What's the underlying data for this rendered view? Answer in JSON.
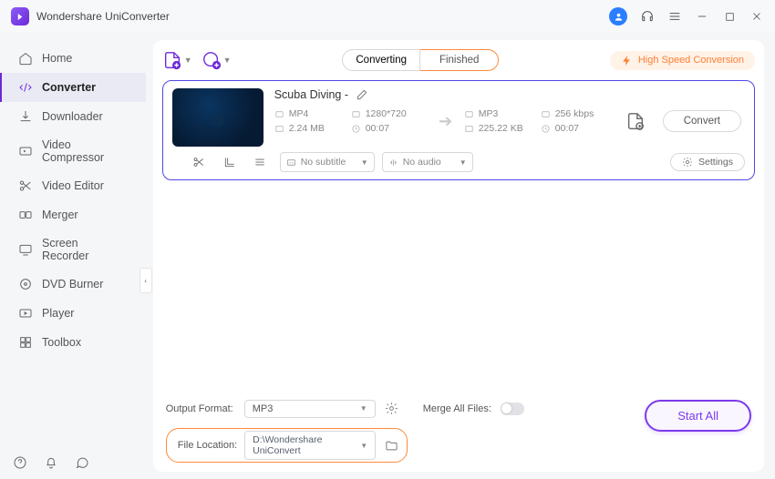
{
  "app": {
    "title": "Wondershare UniConverter"
  },
  "sidebar": {
    "items": [
      {
        "label": "Home"
      },
      {
        "label": "Converter"
      },
      {
        "label": "Downloader"
      },
      {
        "label": "Video Compressor"
      },
      {
        "label": "Video Editor"
      },
      {
        "label": "Merger"
      },
      {
        "label": "Screen Recorder"
      },
      {
        "label": "DVD Burner"
      },
      {
        "label": "Player"
      },
      {
        "label": "Toolbox"
      }
    ]
  },
  "tabs": {
    "converting": "Converting",
    "finished": "Finished"
  },
  "top": {
    "high_speed": "High Speed Conversion"
  },
  "file": {
    "name": "Scuba Diving - ",
    "src": {
      "format": "MP4",
      "resolution": "1280*720",
      "size": "2.24 MB",
      "duration": "00:07"
    },
    "dst": {
      "format": "MP3",
      "bitrate": "256 kbps",
      "size": "225.22 KB",
      "duration": "00:07"
    },
    "subtitle_sel": "No subtitle",
    "audio_sel": "No audio",
    "settings_label": "Settings",
    "convert_label": "Convert"
  },
  "bottom": {
    "output_format_label": "Output Format:",
    "output_format_value": "MP3",
    "merge_label": "Merge All Files:",
    "file_location_label": "File Location:",
    "file_location_value": "D:\\Wondershare UniConvert",
    "start_all": "Start All"
  }
}
